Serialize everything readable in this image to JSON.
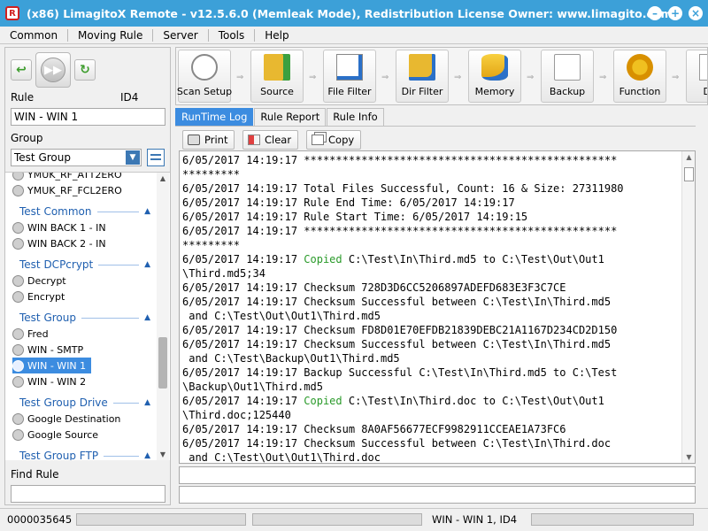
{
  "window": {
    "title": "(x86) LimagitoX Remote - v12.5.6.0 (Memleak Mode), Redistribution License Owner: www.limagito.com",
    "app_icon_letter": "R"
  },
  "menu": [
    "Common",
    "Moving Rule",
    "Server",
    "Tools",
    "Help"
  ],
  "left": {
    "rule_label": "Rule",
    "rule_id": "ID4",
    "rule_value": "WIN - WIN 1",
    "group_label": "Group",
    "group_value": "Test Group",
    "find_label": "Find Rule",
    "find_value": ""
  },
  "rule_tree": [
    {
      "kind": "item",
      "label": "YMUK_RF_ATT2ERO"
    },
    {
      "kind": "item",
      "label": "YMUK_RF_FCL2ERO"
    },
    {
      "kind": "group",
      "label": "Test Common"
    },
    {
      "kind": "item",
      "label": "WIN BACK 1 - IN"
    },
    {
      "kind": "item",
      "label": "WIN BACK 2 - IN"
    },
    {
      "kind": "group",
      "label": "Test DCPcrypt"
    },
    {
      "kind": "item",
      "label": "Decrypt"
    },
    {
      "kind": "item",
      "label": "Encrypt"
    },
    {
      "kind": "group",
      "label": "Test Group"
    },
    {
      "kind": "item",
      "label": "Fred"
    },
    {
      "kind": "item",
      "label": "WIN - SMTP"
    },
    {
      "kind": "item",
      "label": "WIN - WIN 1",
      "selected": true
    },
    {
      "kind": "item",
      "label": "WIN - WIN 2"
    },
    {
      "kind": "group",
      "label": "Test Group Drive"
    },
    {
      "kind": "item",
      "label": "Google Destination"
    },
    {
      "kind": "item",
      "label": "Google Source"
    },
    {
      "kind": "group",
      "label": "Test Group FTP"
    }
  ],
  "toolbar": [
    {
      "label": "Scan Setup",
      "icon": "clock-icon"
    },
    {
      "label": "Source",
      "icon": "source-folder-icon"
    },
    {
      "label": "File Filter",
      "icon": "file-filter-icon"
    },
    {
      "label": "Dir Filter",
      "icon": "dir-filter-icon"
    },
    {
      "label": "Memory",
      "icon": "memory-database-icon"
    },
    {
      "label": "Backup",
      "icon": "backup-document-icon"
    },
    {
      "label": "Function",
      "icon": "function-gear-icon"
    },
    {
      "label": "Des",
      "icon": "destination-icon"
    }
  ],
  "tabs": [
    {
      "label": "RunTime Log",
      "active": true
    },
    {
      "label": "Rule Report"
    },
    {
      "label": "Rule Info"
    }
  ],
  "actions": {
    "print": "Print",
    "clear": "Clear",
    "copy": "Copy"
  },
  "log": [
    {
      "ts": "6/05/2017 14:19:17 ",
      "msg": "*************************************************"
    },
    {
      "ts": "",
      "msg": "*********"
    },
    {
      "ts": "6/05/2017 14:19:17 ",
      "msg": "Total Files Successful, Count: 16 & Size: 27311980"
    },
    {
      "ts": "6/05/2017 14:19:17 ",
      "msg": "Rule End Time: 6/05/2017 14:19:17"
    },
    {
      "ts": "6/05/2017 14:19:17 ",
      "msg": "Rule Start Time: 6/05/2017 14:19:15"
    },
    {
      "ts": "6/05/2017 14:19:17 ",
      "msg": "*************************************************"
    },
    {
      "ts": "",
      "msg": "*********"
    },
    {
      "ts": "6/05/2017 14:19:17 ",
      "msg": "Copied",
      "rest": " C:\\Test\\In\\Third.md5 to C:\\Test\\Out\\Out1",
      "green": true
    },
    {
      "ts": "",
      "msg": "\\Third.md5;34"
    },
    {
      "ts": "6/05/2017 14:19:17 ",
      "msg": "Checksum 728D3D6CC5206897ADEFD683E3F3C7CE"
    },
    {
      "ts": "6/05/2017 14:19:17 ",
      "msg": "Checksum Successful between C:\\Test\\In\\Third.md5"
    },
    {
      "ts": "",
      "msg": " and C:\\Test\\Out\\Out1\\Third.md5"
    },
    {
      "ts": "6/05/2017 14:19:17 ",
      "msg": "Checksum FD8D01E70EFDB21839DEBC21A1167D234CD2D150"
    },
    {
      "ts": "6/05/2017 14:19:17 ",
      "msg": "Checksum Successful between C:\\Test\\In\\Third.md5"
    },
    {
      "ts": "",
      "msg": " and C:\\Test\\Backup\\Out1\\Third.md5"
    },
    {
      "ts": "6/05/2017 14:19:17 ",
      "msg": "Backup Successful C:\\Test\\In\\Third.md5 to C:\\Test"
    },
    {
      "ts": "",
      "msg": "\\Backup\\Out1\\Third.md5"
    },
    {
      "ts": "6/05/2017 14:19:17 ",
      "msg": "Copied",
      "rest": " C:\\Test\\In\\Third.doc to C:\\Test\\Out\\Out1",
      "green": true
    },
    {
      "ts": "",
      "msg": "\\Third.doc;125440"
    },
    {
      "ts": "6/05/2017 14:19:17 ",
      "msg": "Checksum 8A0AF56677ECF9982911CCEAE1A73FC6"
    },
    {
      "ts": "6/05/2017 14:19:17 ",
      "msg": "Checksum Successful between C:\\Test\\In\\Third.doc"
    },
    {
      "ts": "",
      "msg": " and C:\\Test\\Out\\Out1\\Third.doc"
    }
  ],
  "status": {
    "counter": "0000035645",
    "rule_info": "WIN - WIN 1, ID4"
  },
  "colors": {
    "titlebar": "#3ca0d8",
    "selection": "#3c8ce0",
    "log_copied": "#2a9a2a",
    "group_header": "#2060b0"
  }
}
